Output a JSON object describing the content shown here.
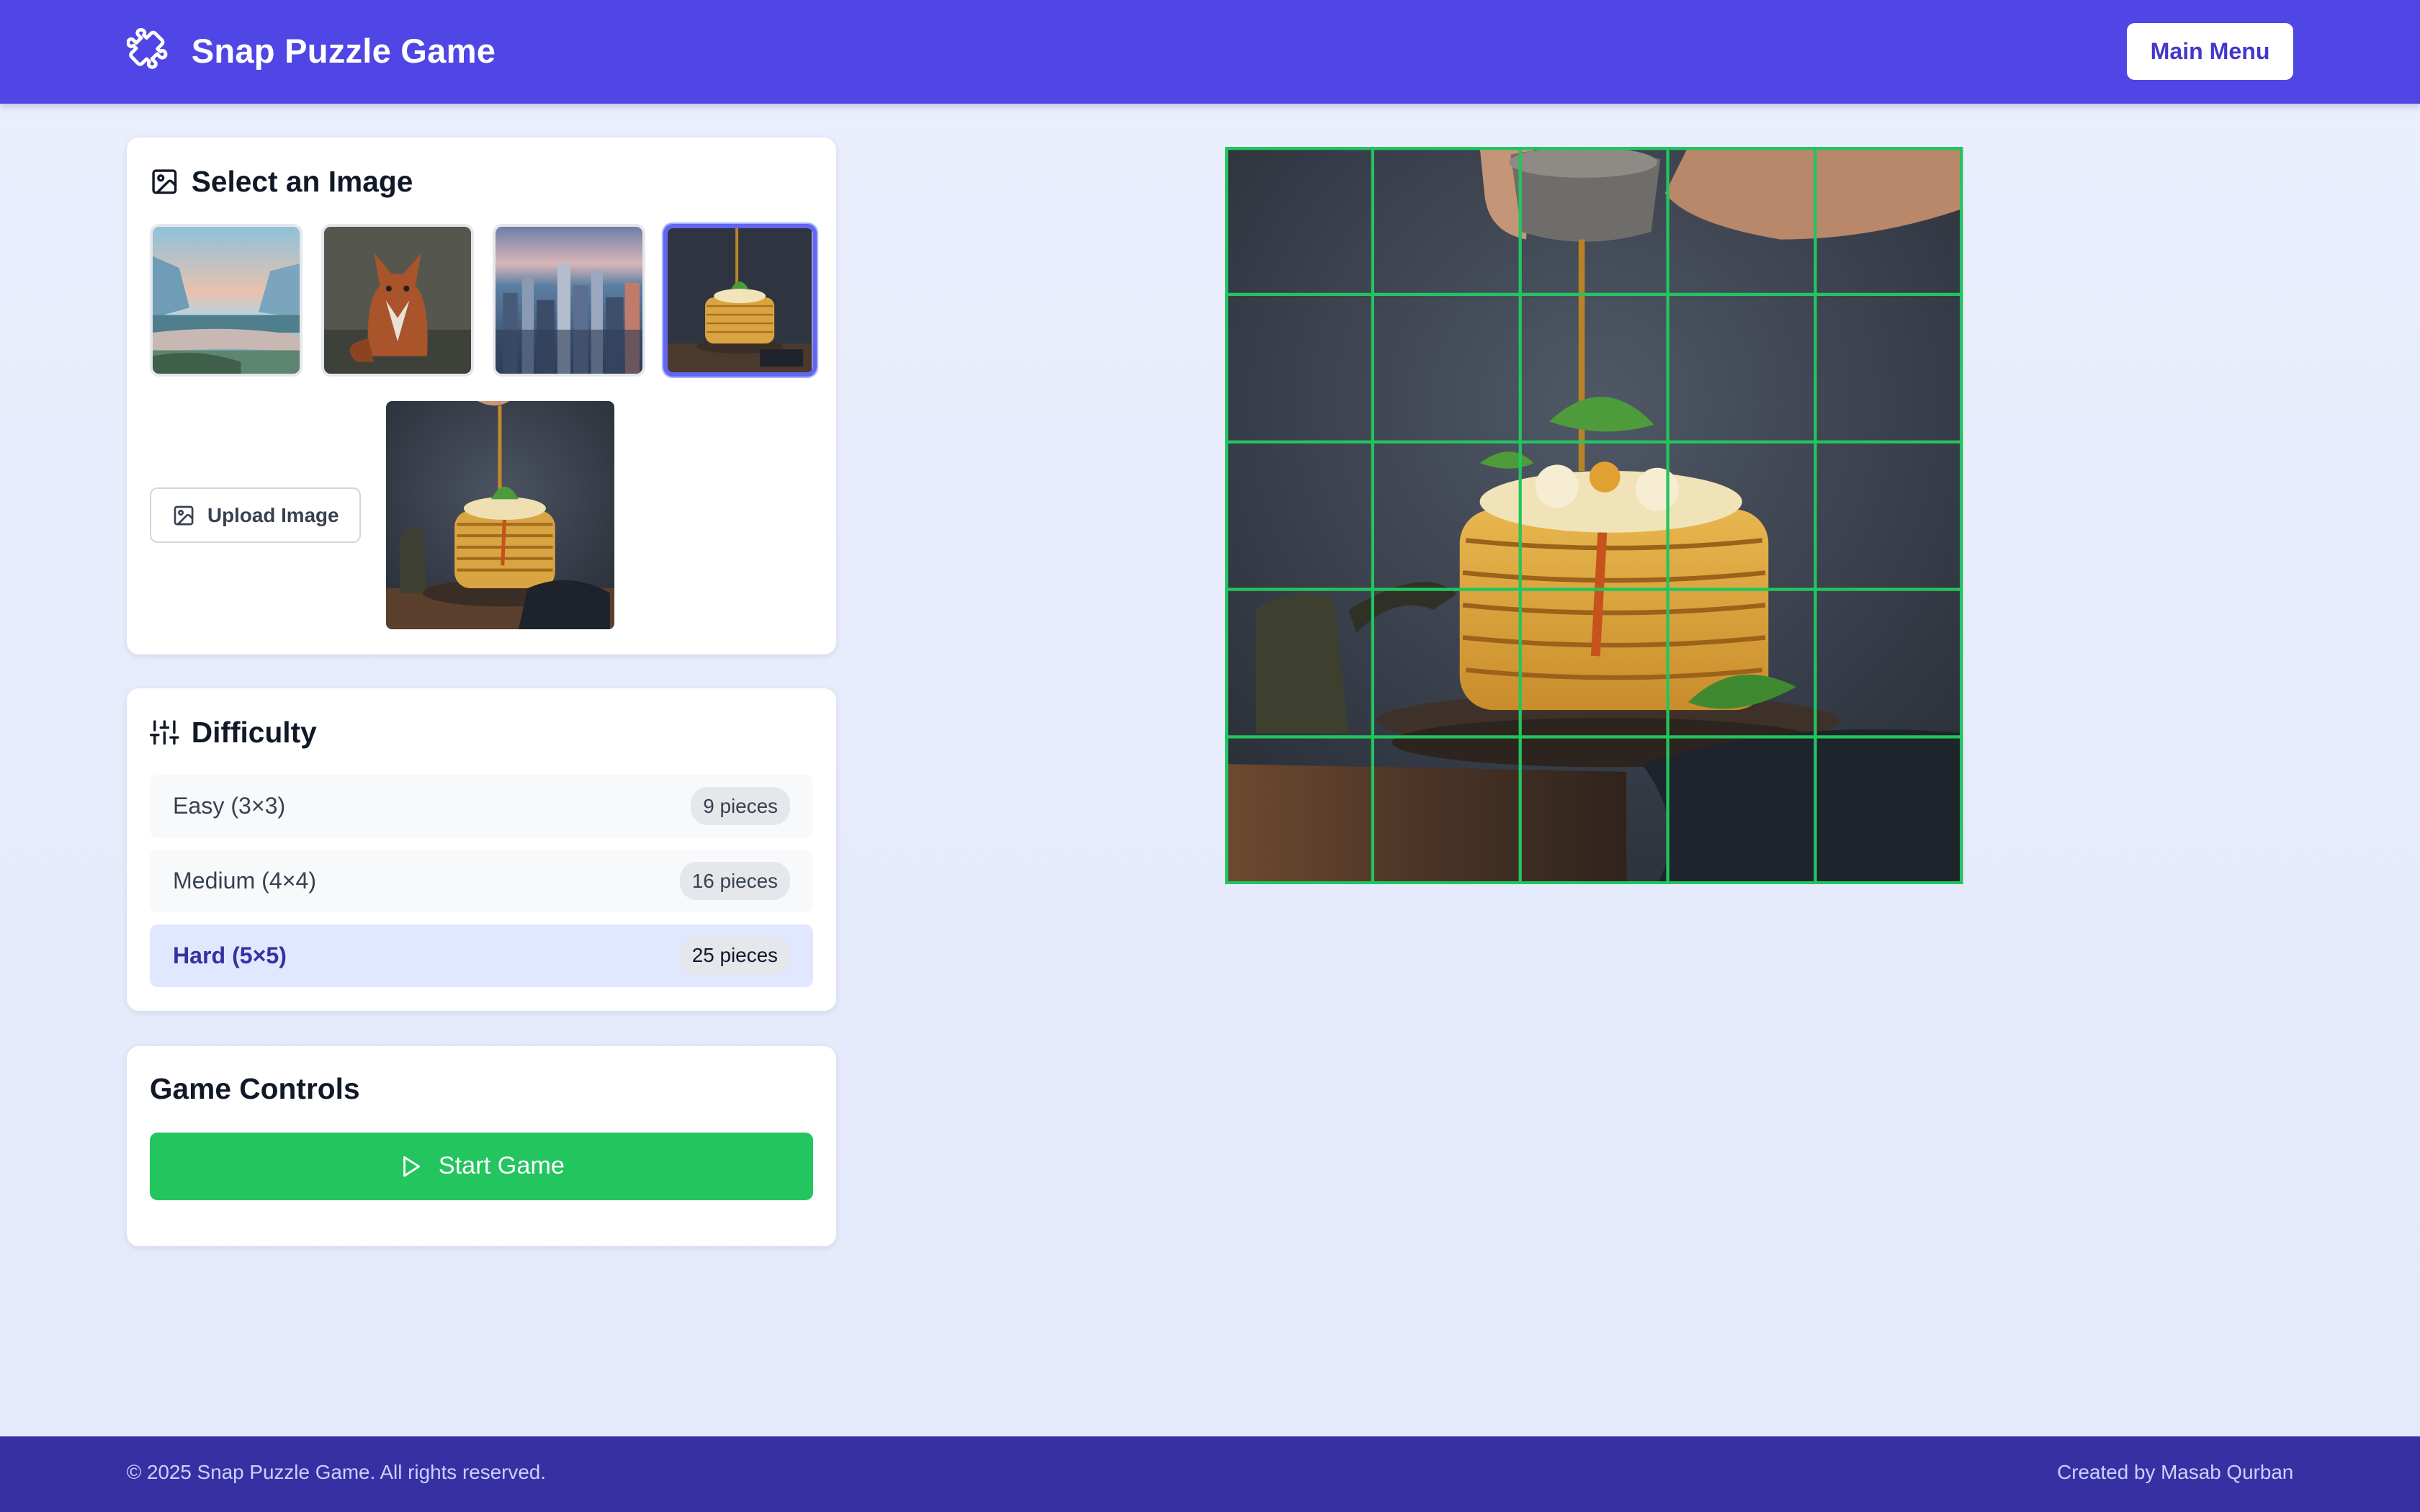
{
  "header": {
    "title": "Snap Puzzle Game",
    "main_menu_label": "Main Menu",
    "brand_icon": "puzzle-piece-icon"
  },
  "image_select": {
    "title": "Select an Image",
    "icon": "image-icon",
    "thumbnails": [
      {
        "name": "mountain-lake",
        "selected": false
      },
      {
        "name": "fox",
        "selected": false
      },
      {
        "name": "city-skyline",
        "selected": false
      },
      {
        "name": "pancakes",
        "selected": true
      }
    ],
    "upload_label": "Upload Image"
  },
  "difficulty": {
    "title": "Difficulty",
    "icon": "sliders-icon",
    "options": [
      {
        "label": "Easy (3×3)",
        "pieces": "9 pieces",
        "active": false
      },
      {
        "label": "Medium (4×4)",
        "pieces": "16 pieces",
        "active": false
      },
      {
        "label": "Hard (5×5)",
        "pieces": "25 pieces",
        "active": true
      }
    ]
  },
  "controls": {
    "title": "Game Controls",
    "start_label": "Start Game"
  },
  "board": {
    "grid_size": 5,
    "grid_color": "#22c55e"
  },
  "footer": {
    "copyright": "© 2025 Snap Puzzle Game. All rights reserved.",
    "credit": "Created by Masab Qurban"
  },
  "colors": {
    "brand": "#4f46e5",
    "footer": "#3730a3",
    "success": "#22c55e",
    "accent_light": "#e0e7ff"
  }
}
